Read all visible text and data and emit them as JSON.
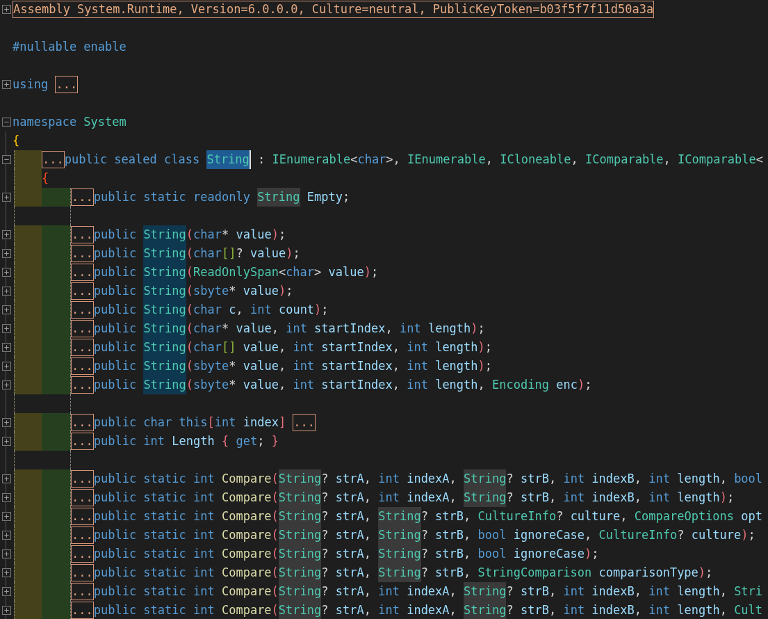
{
  "lines": [
    {
      "kind": "code",
      "expanded": false,
      "tokens": [
        {
          "kind": "header",
          "text": "Assembly System.Runtime, Version=6.0.0.0, Culture=neutral, PublicKeyToken=b03f5f7f11d50a3a"
        }
      ]
    },
    {
      "kind": "blank"
    },
    {
      "kind": "code",
      "tokens": [
        {
          "kind": "keyword",
          "text": "#nullable enable"
        }
      ]
    },
    {
      "kind": "blank"
    },
    {
      "kind": "code",
      "expanded": false,
      "tokens": [
        {
          "kind": "keyword",
          "text": "using "
        },
        {
          "kind": "collapsed",
          "text": "..."
        }
      ]
    },
    {
      "kind": "blank"
    },
    {
      "kind": "code",
      "expanded": true,
      "tokens": [
        {
          "kind": "keyword",
          "text": "namespace "
        },
        {
          "kind": "type",
          "text": "System"
        }
      ],
      "open": {
        "kind": "bracket1",
        "text": "{"
      },
      "children": [
        {
          "kind": "code",
          "expanded": true,
          "tokens": [
            {
              "kind": "collapsed",
              "text": "..."
            },
            {
              "kind": "keyword",
              "text": "public sealed class "
            },
            {
              "kind": "type-selected",
              "text": "String"
            },
            {
              "kind": "punct",
              "text": " : "
            },
            {
              "kind": "type",
              "text": "IEnumerable"
            },
            {
              "kind": "punct",
              "text": "<"
            },
            {
              "kind": "keyword",
              "text": "char"
            },
            {
              "kind": "punct",
              "text": ">, "
            },
            {
              "kind": "type",
              "text": "IEnumerable"
            },
            {
              "kind": "punct",
              "text": ", "
            },
            {
              "kind": "type",
              "text": "ICloneable"
            },
            {
              "kind": "punct",
              "text": ", "
            },
            {
              "kind": "type",
              "text": "IComparable"
            },
            {
              "kind": "punct",
              "text": ", "
            },
            {
              "kind": "type",
              "text": "IComparable"
            },
            {
              "kind": "punct",
              "text": "<"
            }
          ],
          "open": {
            "kind": "bracket2",
            "text": "{"
          },
          "children": [
            {
              "kind": "code",
              "expanded": false,
              "tokens": [
                {
                  "kind": "collapsed",
                  "text": "..."
                },
                {
                  "kind": "keyword",
                  "text": "public static readonly "
                },
                {
                  "kind": "type-reference",
                  "text": "String"
                },
                {
                  "kind": "name",
                  "text": " Empty"
                },
                {
                  "kind": "punct",
                  "text": ";"
                }
              ]
            },
            {
              "kind": "blank"
            },
            {
              "kind": "code",
              "expanded": false,
              "tokens": [
                {
                  "kind": "collapsed",
                  "text": "..."
                },
                {
                  "kind": "keyword",
                  "text": "public "
                },
                {
                  "kind": "type-definition",
                  "text": "String"
                },
                {
                  "kind": "bracket3",
                  "text": "("
                },
                {
                  "kind": "keyword",
                  "text": "char"
                },
                {
                  "kind": "punct",
                  "text": "* "
                },
                {
                  "kind": "name",
                  "text": "value"
                },
                {
                  "kind": "bracket3",
                  "text": ")"
                },
                {
                  "kind": "punct",
                  "text": ";"
                }
              ]
            },
            {
              "kind": "code",
              "expanded": false,
              "tokens": [
                {
                  "kind": "collapsed",
                  "text": "..."
                },
                {
                  "kind": "keyword",
                  "text": "public "
                },
                {
                  "kind": "type-definition",
                  "text": "String"
                },
                {
                  "kind": "bracket3",
                  "text": "("
                },
                {
                  "kind": "keyword",
                  "text": "char"
                },
                {
                  "kind": "bracket4",
                  "text": "[]"
                },
                {
                  "kind": "punct",
                  "text": "? "
                },
                {
                  "kind": "name",
                  "text": "value"
                },
                {
                  "kind": "bracket3",
                  "text": ")"
                },
                {
                  "kind": "punct",
                  "text": ";"
                }
              ]
            },
            {
              "kind": "code",
              "expanded": false,
              "tokens": [
                {
                  "kind": "collapsed",
                  "text": "..."
                },
                {
                  "kind": "keyword",
                  "text": "public "
                },
                {
                  "kind": "type-definition",
                  "text": "String"
                },
                {
                  "kind": "bracket3",
                  "text": "("
                },
                {
                  "kind": "type",
                  "text": "ReadOnlySpan"
                },
                {
                  "kind": "punct",
                  "text": "<"
                },
                {
                  "kind": "keyword",
                  "text": "char"
                },
                {
                  "kind": "punct",
                  "text": "> "
                },
                {
                  "kind": "name",
                  "text": "value"
                },
                {
                  "kind": "bracket3",
                  "text": ")"
                },
                {
                  "kind": "punct",
                  "text": ";"
                }
              ]
            },
            {
              "kind": "code",
              "expanded": false,
              "tokens": [
                {
                  "kind": "collapsed",
                  "text": "..."
                },
                {
                  "kind": "keyword",
                  "text": "public "
                },
                {
                  "kind": "type-definition",
                  "text": "String"
                },
                {
                  "kind": "bracket3",
                  "text": "("
                },
                {
                  "kind": "keyword",
                  "text": "sbyte"
                },
                {
                  "kind": "punct",
                  "text": "* "
                },
                {
                  "kind": "name",
                  "text": "value"
                },
                {
                  "kind": "bracket3",
                  "text": ")"
                },
                {
                  "kind": "punct",
                  "text": ";"
                }
              ]
            },
            {
              "kind": "code",
              "expanded": false,
              "tokens": [
                {
                  "kind": "collapsed",
                  "text": "..."
                },
                {
                  "kind": "keyword",
                  "text": "public "
                },
                {
                  "kind": "type-definition",
                  "text": "String"
                },
                {
                  "kind": "bracket3",
                  "text": "("
                },
                {
                  "kind": "keyword",
                  "text": "char "
                },
                {
                  "kind": "name",
                  "text": "c"
                },
                {
                  "kind": "punct",
                  "text": ", "
                },
                {
                  "kind": "keyword",
                  "text": "int "
                },
                {
                  "kind": "name",
                  "text": "count"
                },
                {
                  "kind": "bracket3",
                  "text": ")"
                },
                {
                  "kind": "punct",
                  "text": ";"
                }
              ]
            },
            {
              "kind": "code",
              "expanded": false,
              "tokens": [
                {
                  "kind": "collapsed",
                  "text": "..."
                },
                {
                  "kind": "keyword",
                  "text": "public "
                },
                {
                  "kind": "type-definition",
                  "text": "String"
                },
                {
                  "kind": "bracket3",
                  "text": "("
                },
                {
                  "kind": "keyword",
                  "text": "char"
                },
                {
                  "kind": "punct",
                  "text": "* "
                },
                {
                  "kind": "name",
                  "text": "value"
                },
                {
                  "kind": "punct",
                  "text": ", "
                },
                {
                  "kind": "keyword",
                  "text": "int "
                },
                {
                  "kind": "name",
                  "text": "startIndex"
                },
                {
                  "kind": "punct",
                  "text": ", "
                },
                {
                  "kind": "keyword",
                  "text": "int "
                },
                {
                  "kind": "name",
                  "text": "length"
                },
                {
                  "kind": "bracket3",
                  "text": ")"
                },
                {
                  "kind": "punct",
                  "text": ";"
                }
              ]
            },
            {
              "kind": "code",
              "expanded": false,
              "tokens": [
                {
                  "kind": "collapsed",
                  "text": "..."
                },
                {
                  "kind": "keyword",
                  "text": "public "
                },
                {
                  "kind": "type-definition",
                  "text": "String"
                },
                {
                  "kind": "bracket3",
                  "text": "("
                },
                {
                  "kind": "keyword",
                  "text": "char"
                },
                {
                  "kind": "bracket4",
                  "text": "[]"
                },
                {
                  "kind": "name",
                  "text": " value"
                },
                {
                  "kind": "punct",
                  "text": ", "
                },
                {
                  "kind": "keyword",
                  "text": "int "
                },
                {
                  "kind": "name",
                  "text": "startIndex"
                },
                {
                  "kind": "punct",
                  "text": ", "
                },
                {
                  "kind": "keyword",
                  "text": "int "
                },
                {
                  "kind": "name",
                  "text": "length"
                },
                {
                  "kind": "bracket3",
                  "text": ")"
                },
                {
                  "kind": "punct",
                  "text": ";"
                }
              ]
            },
            {
              "kind": "code",
              "expanded": false,
              "tokens": [
                {
                  "kind": "collapsed",
                  "text": "..."
                },
                {
                  "kind": "keyword",
                  "text": "public "
                },
                {
                  "kind": "type-definition",
                  "text": "String"
                },
                {
                  "kind": "bracket3",
                  "text": "("
                },
                {
                  "kind": "keyword",
                  "text": "sbyte"
                },
                {
                  "kind": "punct",
                  "text": "* "
                },
                {
                  "kind": "name",
                  "text": "value"
                },
                {
                  "kind": "punct",
                  "text": ", "
                },
                {
                  "kind": "keyword",
                  "text": "int "
                },
                {
                  "kind": "name",
                  "text": "startIndex"
                },
                {
                  "kind": "punct",
                  "text": ", "
                },
                {
                  "kind": "keyword",
                  "text": "int "
                },
                {
                  "kind": "name",
                  "text": "length"
                },
                {
                  "kind": "bracket3",
                  "text": ")"
                },
                {
                  "kind": "punct",
                  "text": ";"
                }
              ]
            },
            {
              "kind": "code",
              "expanded": false,
              "tokens": [
                {
                  "kind": "collapsed",
                  "text": "..."
                },
                {
                  "kind": "keyword",
                  "text": "public "
                },
                {
                  "kind": "type-definition",
                  "text": "String"
                },
                {
                  "kind": "bracket3",
                  "text": "("
                },
                {
                  "kind": "keyword",
                  "text": "sbyte"
                },
                {
                  "kind": "punct",
                  "text": "* "
                },
                {
                  "kind": "name",
                  "text": "value"
                },
                {
                  "kind": "punct",
                  "text": ", "
                },
                {
                  "kind": "keyword",
                  "text": "int "
                },
                {
                  "kind": "name",
                  "text": "startIndex"
                },
                {
                  "kind": "punct",
                  "text": ", "
                },
                {
                  "kind": "keyword",
                  "text": "int "
                },
                {
                  "kind": "name",
                  "text": "length"
                },
                {
                  "kind": "punct",
                  "text": ", "
                },
                {
                  "kind": "type",
                  "text": "Encoding"
                },
                {
                  "kind": "name",
                  "text": " enc"
                },
                {
                  "kind": "bracket3",
                  "text": ")"
                },
                {
                  "kind": "punct",
                  "text": ";"
                }
              ]
            },
            {
              "kind": "blank"
            },
            {
              "kind": "code",
              "expanded": false,
              "tokens": [
                {
                  "kind": "collapsed",
                  "text": "..."
                },
                {
                  "kind": "keyword",
                  "text": "public char this"
                },
                {
                  "kind": "bracket3",
                  "text": "["
                },
                {
                  "kind": "keyword",
                  "text": "int "
                },
                {
                  "kind": "name",
                  "text": "index"
                },
                {
                  "kind": "bracket3",
                  "text": "] "
                },
                {
                  "kind": "collapsed",
                  "text": "..."
                }
              ]
            },
            {
              "kind": "code",
              "expanded": false,
              "tokens": [
                {
                  "kind": "collapsed",
                  "text": "..."
                },
                {
                  "kind": "keyword",
                  "text": "public int "
                },
                {
                  "kind": "name",
                  "text": "Length "
                },
                {
                  "kind": "bracket3",
                  "text": "{"
                },
                {
                  "kind": "keyword",
                  "text": " get"
                },
                {
                  "kind": "punct",
                  "text": "; "
                },
                {
                  "kind": "bracket3",
                  "text": "}"
                }
              ]
            },
            {
              "kind": "blank"
            },
            {
              "kind": "code",
              "expanded": false,
              "tokens": [
                {
                  "kind": "collapsed",
                  "text": "..."
                },
                {
                  "kind": "keyword",
                  "text": "public static int "
                },
                {
                  "kind": "method",
                  "text": "Compare"
                },
                {
                  "kind": "bracket3",
                  "text": "("
                },
                {
                  "kind": "type-reference",
                  "text": "String"
                },
                {
                  "kind": "punct",
                  "text": "? "
                },
                {
                  "kind": "name",
                  "text": "strA"
                },
                {
                  "kind": "punct",
                  "text": ", "
                },
                {
                  "kind": "keyword",
                  "text": "int "
                },
                {
                  "kind": "name",
                  "text": "indexA"
                },
                {
                  "kind": "punct",
                  "text": ", "
                },
                {
                  "kind": "type-reference",
                  "text": "String"
                },
                {
                  "kind": "punct",
                  "text": "? "
                },
                {
                  "kind": "name",
                  "text": "strB"
                },
                {
                  "kind": "punct",
                  "text": ", "
                },
                {
                  "kind": "keyword",
                  "text": "int "
                },
                {
                  "kind": "name",
                  "text": "indexB"
                },
                {
                  "kind": "punct",
                  "text": ", "
                },
                {
                  "kind": "keyword",
                  "text": "int "
                },
                {
                  "kind": "name",
                  "text": "length"
                },
                {
                  "kind": "punct",
                  "text": ", "
                },
                {
                  "kind": "keyword",
                  "text": "bool"
                }
              ]
            },
            {
              "kind": "code",
              "expanded": false,
              "tokens": [
                {
                  "kind": "collapsed",
                  "text": "..."
                },
                {
                  "kind": "keyword",
                  "text": "public static int "
                },
                {
                  "kind": "method",
                  "text": "Compare"
                },
                {
                  "kind": "bracket3",
                  "text": "("
                },
                {
                  "kind": "type-reference",
                  "text": "String"
                },
                {
                  "kind": "punct",
                  "text": "? "
                },
                {
                  "kind": "name",
                  "text": "strA"
                },
                {
                  "kind": "punct",
                  "text": ", "
                },
                {
                  "kind": "keyword",
                  "text": "int "
                },
                {
                  "kind": "name",
                  "text": "indexA"
                },
                {
                  "kind": "punct",
                  "text": ", "
                },
                {
                  "kind": "type-reference",
                  "text": "String"
                },
                {
                  "kind": "punct",
                  "text": "? "
                },
                {
                  "kind": "name",
                  "text": "strB"
                },
                {
                  "kind": "punct",
                  "text": ", "
                },
                {
                  "kind": "keyword",
                  "text": "int "
                },
                {
                  "kind": "name",
                  "text": "indexB"
                },
                {
                  "kind": "punct",
                  "text": ", "
                },
                {
                  "kind": "keyword",
                  "text": "int "
                },
                {
                  "kind": "name",
                  "text": "length"
                },
                {
                  "kind": "bracket3",
                  "text": ")"
                },
                {
                  "kind": "punct",
                  "text": ";"
                }
              ]
            },
            {
              "kind": "code",
              "expanded": false,
              "tokens": [
                {
                  "kind": "collapsed",
                  "text": "..."
                },
                {
                  "kind": "keyword",
                  "text": "public static int "
                },
                {
                  "kind": "method",
                  "text": "Compare"
                },
                {
                  "kind": "bracket3",
                  "text": "("
                },
                {
                  "kind": "type-reference",
                  "text": "String"
                },
                {
                  "kind": "punct",
                  "text": "? "
                },
                {
                  "kind": "name",
                  "text": "strA"
                },
                {
                  "kind": "punct",
                  "text": ", "
                },
                {
                  "kind": "type-reference",
                  "text": "String"
                },
                {
                  "kind": "punct",
                  "text": "? "
                },
                {
                  "kind": "name",
                  "text": "strB"
                },
                {
                  "kind": "punct",
                  "text": ", "
                },
                {
                  "kind": "type",
                  "text": "CultureInfo"
                },
                {
                  "kind": "punct",
                  "text": "? "
                },
                {
                  "kind": "name",
                  "text": "culture"
                },
                {
                  "kind": "punct",
                  "text": ", "
                },
                {
                  "kind": "type",
                  "text": "CompareOptions"
                },
                {
                  "kind": "name",
                  "text": " opt"
                }
              ]
            },
            {
              "kind": "code",
              "expanded": false,
              "tokens": [
                {
                  "kind": "collapsed",
                  "text": "..."
                },
                {
                  "kind": "keyword",
                  "text": "public static int "
                },
                {
                  "kind": "method",
                  "text": "Compare"
                },
                {
                  "kind": "bracket3",
                  "text": "("
                },
                {
                  "kind": "type-reference",
                  "text": "String"
                },
                {
                  "kind": "punct",
                  "text": "? "
                },
                {
                  "kind": "name",
                  "text": "strA"
                },
                {
                  "kind": "punct",
                  "text": ", "
                },
                {
                  "kind": "type-reference",
                  "text": "String"
                },
                {
                  "kind": "punct",
                  "text": "? "
                },
                {
                  "kind": "name",
                  "text": "strB"
                },
                {
                  "kind": "punct",
                  "text": ", "
                },
                {
                  "kind": "keyword",
                  "text": "bool "
                },
                {
                  "kind": "name",
                  "text": "ignoreCase"
                },
                {
                  "kind": "punct",
                  "text": ", "
                },
                {
                  "kind": "type",
                  "text": "CultureInfo"
                },
                {
                  "kind": "punct",
                  "text": "? "
                },
                {
                  "kind": "name",
                  "text": "culture"
                },
                {
                  "kind": "bracket3",
                  "text": ")"
                },
                {
                  "kind": "punct",
                  "text": ";"
                }
              ]
            },
            {
              "kind": "code",
              "expanded": false,
              "tokens": [
                {
                  "kind": "collapsed",
                  "text": "..."
                },
                {
                  "kind": "keyword",
                  "text": "public static int "
                },
                {
                  "kind": "method",
                  "text": "Compare"
                },
                {
                  "kind": "bracket3",
                  "text": "("
                },
                {
                  "kind": "type-reference",
                  "text": "String"
                },
                {
                  "kind": "punct",
                  "text": "? "
                },
                {
                  "kind": "name",
                  "text": "strA"
                },
                {
                  "kind": "punct",
                  "text": ", "
                },
                {
                  "kind": "type-reference",
                  "text": "String"
                },
                {
                  "kind": "punct",
                  "text": "? "
                },
                {
                  "kind": "name",
                  "text": "strB"
                },
                {
                  "kind": "punct",
                  "text": ", "
                },
                {
                  "kind": "keyword",
                  "text": "bool "
                },
                {
                  "kind": "name",
                  "text": "ignoreCase"
                },
                {
                  "kind": "bracket3",
                  "text": ")"
                },
                {
                  "kind": "punct",
                  "text": ";"
                }
              ]
            },
            {
              "kind": "code",
              "expanded": false,
              "tokens": [
                {
                  "kind": "collapsed",
                  "text": "..."
                },
                {
                  "kind": "keyword",
                  "text": "public static int "
                },
                {
                  "kind": "method",
                  "text": "Compare"
                },
                {
                  "kind": "bracket3",
                  "text": "("
                },
                {
                  "kind": "type-reference",
                  "text": "String"
                },
                {
                  "kind": "punct",
                  "text": "? "
                },
                {
                  "kind": "name",
                  "text": "strA"
                },
                {
                  "kind": "punct",
                  "text": ", "
                },
                {
                  "kind": "type-reference",
                  "text": "String"
                },
                {
                  "kind": "punct",
                  "text": "? "
                },
                {
                  "kind": "name",
                  "text": "strB"
                },
                {
                  "kind": "punct",
                  "text": ", "
                },
                {
                  "kind": "type",
                  "text": "StringComparison"
                },
                {
                  "kind": "name",
                  "text": " comparisonType"
                },
                {
                  "kind": "bracket3",
                  "text": ")"
                },
                {
                  "kind": "punct",
                  "text": ";"
                }
              ]
            },
            {
              "kind": "code",
              "expanded": false,
              "tokens": [
                {
                  "kind": "collapsed",
                  "text": "..."
                },
                {
                  "kind": "keyword",
                  "text": "public static int "
                },
                {
                  "kind": "method",
                  "text": "Compare"
                },
                {
                  "kind": "bracket3",
                  "text": "("
                },
                {
                  "kind": "type-reference",
                  "text": "String"
                },
                {
                  "kind": "punct",
                  "text": "? "
                },
                {
                  "kind": "name",
                  "text": "strA"
                },
                {
                  "kind": "punct",
                  "text": ", "
                },
                {
                  "kind": "keyword",
                  "text": "int "
                },
                {
                  "kind": "name",
                  "text": "indexA"
                },
                {
                  "kind": "punct",
                  "text": ", "
                },
                {
                  "kind": "type-reference",
                  "text": "String"
                },
                {
                  "kind": "punct",
                  "text": "? "
                },
                {
                  "kind": "name",
                  "text": "strB"
                },
                {
                  "kind": "punct",
                  "text": ", "
                },
                {
                  "kind": "keyword",
                  "text": "int "
                },
                {
                  "kind": "name",
                  "text": "indexB"
                },
                {
                  "kind": "punct",
                  "text": ", "
                },
                {
                  "kind": "keyword",
                  "text": "int "
                },
                {
                  "kind": "name",
                  "text": "length"
                },
                {
                  "kind": "punct",
                  "text": ", "
                },
                {
                  "kind": "type",
                  "text": "Stri"
                }
              ]
            },
            {
              "kind": "code",
              "expanded": false,
              "tokens": [
                {
                  "kind": "collapsed",
                  "text": "..."
                },
                {
                  "kind": "keyword",
                  "text": "public static int "
                },
                {
                  "kind": "method",
                  "text": "Compare"
                },
                {
                  "kind": "bracket3",
                  "text": "("
                },
                {
                  "kind": "type-reference",
                  "text": "String"
                },
                {
                  "kind": "punct",
                  "text": "? "
                },
                {
                  "kind": "name",
                  "text": "strA"
                },
                {
                  "kind": "punct",
                  "text": ", "
                },
                {
                  "kind": "keyword",
                  "text": "int "
                },
                {
                  "kind": "name",
                  "text": "indexA"
                },
                {
                  "kind": "punct",
                  "text": ", "
                },
                {
                  "kind": "type-reference",
                  "text": "String"
                },
                {
                  "kind": "punct",
                  "text": "? "
                },
                {
                  "kind": "name",
                  "text": "strB"
                },
                {
                  "kind": "punct",
                  "text": ", "
                },
                {
                  "kind": "keyword",
                  "text": "int "
                },
                {
                  "kind": "name",
                  "text": "indexB"
                },
                {
                  "kind": "punct",
                  "text": ", "
                },
                {
                  "kind": "keyword",
                  "text": "int "
                },
                {
                  "kind": "name",
                  "text": "length"
                },
                {
                  "kind": "punct",
                  "text": ", "
                },
                {
                  "kind": "type",
                  "text": "Cult"
                }
              ]
            }
          ]
        }
      ]
    }
  ]
}
